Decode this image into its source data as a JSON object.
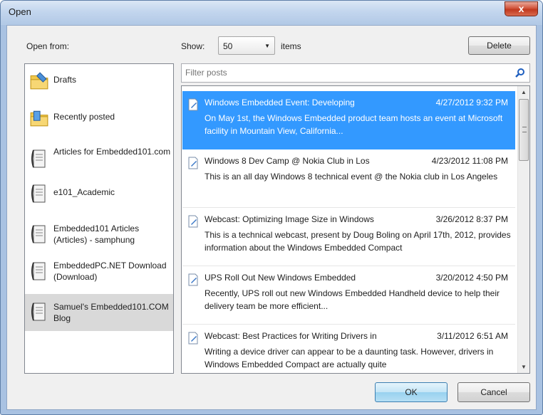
{
  "window": {
    "title": "Open",
    "close_glyph": "x"
  },
  "top": {
    "open_from_label": "Open from:",
    "show_label": "Show:",
    "show_value": "50",
    "items_label": "items",
    "delete_label": "Delete"
  },
  "sources": [
    {
      "label": "Drafts",
      "icon": "folder-draft-icon"
    },
    {
      "label": "Recently posted",
      "icon": "folder-posted-icon"
    },
    {
      "label": "Articles for Embedded101.com",
      "icon": "blog-doc-icon"
    },
    {
      "label": "e101_Academic",
      "icon": "blog-doc-icon"
    },
    {
      "label": "Embedded101 Articles (Articles) - samphung",
      "icon": "blog-doc-icon"
    },
    {
      "label": "EmbeddedPC.NET Download (Download)",
      "icon": "blog-doc-icon"
    },
    {
      "label": "Samuel's Embedded101.COM Blog",
      "icon": "blog-doc-icon",
      "selected": true
    }
  ],
  "filter": {
    "placeholder": "Filter posts"
  },
  "posts": [
    {
      "title": "Windows Embedded Event: Developing",
      "date": "4/27/2012 9:32 PM",
      "desc": "On May 1st, the Windows Embedded product team hosts an event at Microsoft facility in Mountain View, California...",
      "selected": true
    },
    {
      "title": "Windows 8 Dev Camp @ Nokia Club in Los",
      "date": "4/23/2012 11:08 PM",
      "desc": "This is an all day Windows 8 technical event @ the Nokia club in Los Angeles"
    },
    {
      "title": "Webcast: Optimizing Image Size in Windows",
      "date": "3/26/2012 8:37 PM",
      "desc": "This is a technical webcast, present by Doug Boling on April 17th, 2012, provides information about the Windows Embedded Compact"
    },
    {
      "title": "UPS Roll Out New Windows Embedded",
      "date": "3/20/2012 4:50 PM",
      "desc": "Recently, UPS roll out new Windows Embedded Handheld device to help their delivery team be more efficient..."
    },
    {
      "title": "Webcast: Best Practices for Writing Drivers in",
      "date": "3/11/2012 6:51 AM",
      "desc": "Writing a device driver can appear to be a daunting task. However, drivers in Windows Embedded Compact are actually quite"
    }
  ],
  "buttons": {
    "ok_label": "OK",
    "cancel_label": "Cancel"
  },
  "colors": {
    "selection": "#3399ff",
    "source_selected": "#d9d9d9"
  }
}
